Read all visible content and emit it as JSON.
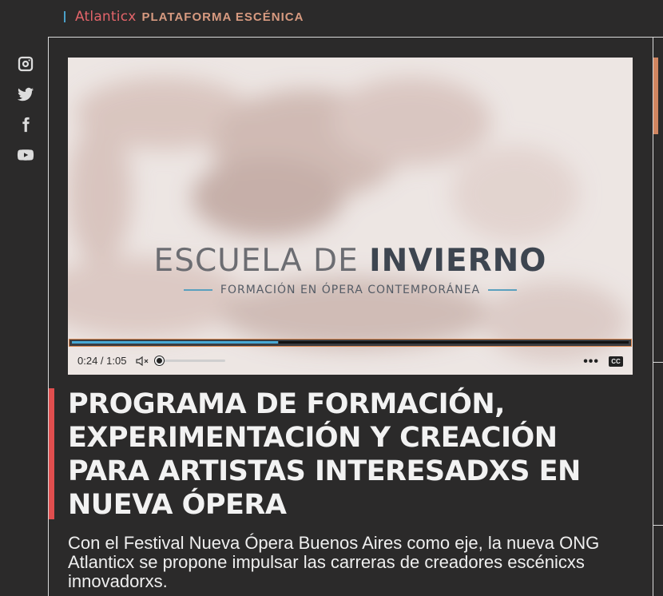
{
  "brand": {
    "name": "Atlanticx",
    "tagline": "PLATAFORMA ESCÉNICA"
  },
  "social": [
    {
      "name": "instagram-icon"
    },
    {
      "name": "twitter-icon"
    },
    {
      "name": "facebook-icon"
    },
    {
      "name": "youtube-icon"
    }
  ],
  "video": {
    "title_light": "ESCUELA DE ",
    "title_bold": "INVIERNO",
    "subtitle": "FORMACIÓN EN ÓPERA CONTEMPORÁNEA",
    "time_display": "0:24 / 1:05",
    "progress_fraction": 0.37,
    "volume_fraction": 0.0,
    "more_label": "•••",
    "cc_label": "CC"
  },
  "article": {
    "headline": "PROGRAMA DE FORMACIÓN, EXPERIMENTACIÓN Y CREACIÓN PARA ARTISTAS INTERESADXS EN NUEVA ÓPERA",
    "lead": "Con el Festival Nueva Ópera Buenos Aires como eje, la nueva ONG Atlanticx se propone impulsar las carreras de creadores escénicxs innovadorxs."
  },
  "colors": {
    "background": "#2b2a2a",
    "brand": "#e2646a",
    "tagline": "#d79a80",
    "accent_red": "#e04e4e",
    "progress": "#47a9d6",
    "scroll_thumb": "#d08560"
  }
}
